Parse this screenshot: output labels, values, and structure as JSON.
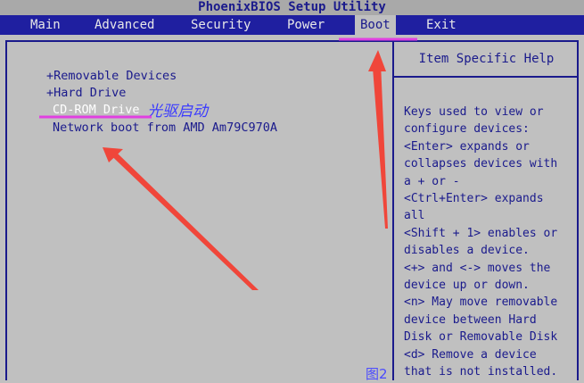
{
  "title": "PhoenixBIOS Setup Utility",
  "menu": [
    {
      "label": "Main"
    },
    {
      "label": "Advanced"
    },
    {
      "label": "Security"
    },
    {
      "label": "Power"
    },
    {
      "label": "Boot"
    },
    {
      "label": "Exit"
    }
  ],
  "boot_items": [
    {
      "label": "+Removable Devices"
    },
    {
      "label": "+Hard Drive"
    },
    {
      "label": "CD-ROM Drive"
    },
    {
      "label": "Network boot from AMD Am79C970A"
    }
  ],
  "help": {
    "title": "Item Specific Help",
    "lines": [
      "Keys used to view or",
      "configure devices:",
      "<Enter> expands or",
      "collapses devices with",
      "a + or -",
      "<Ctrl+Enter> expands",
      "all",
      "<Shift + 1> enables or",
      "disables a device.",
      "<+> and <-> moves the",
      "device up or down.",
      "<n> May move removable",
      "device between Hard",
      "Disk or Removable Disk",
      "<d> Remove a device",
      "that is not installed."
    ]
  },
  "annotation": {
    "label": "光驱启动",
    "figure": "图2",
    "colors": {
      "arrow": "#f0463a",
      "underline": "#e040e0",
      "text": "#3a3aff"
    }
  },
  "colors": {
    "background": "#c0c0c0",
    "menubar": "#1f1fa0",
    "text": "#1a1a8c",
    "selected_text": "#ffffff"
  }
}
